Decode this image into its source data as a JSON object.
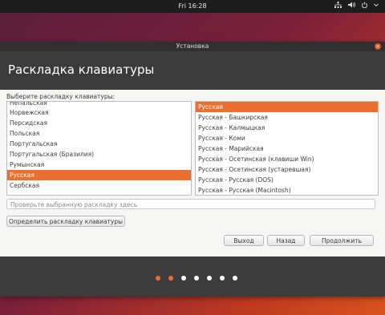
{
  "topbar": {
    "clock": "Fri 16:28"
  },
  "window": {
    "title": "Установка",
    "heading": "Раскладка клавиатуры"
  },
  "layout_prompt": "Выберите раскладку клавиатуры:",
  "layouts_left": [
    "Непальская",
    "Норвежская",
    "Персидская",
    "Польская",
    "Португальская",
    "Португальская (Бразилия)",
    "Румынская",
    "Русская",
    "Сербская"
  ],
  "layouts_left_selected": "Русская",
  "layouts_right": [
    "Русская",
    "Русская - Башкирская",
    "Русская - Калмыцкая",
    "Русская - Коми",
    "Русская - Марийская",
    "Русская - Осетинская (клавиши Win)",
    "Русская - Осетинская (устаревшая)",
    "Русская - Русская (DOS)",
    "Русская - Русская (Macintosh)"
  ],
  "layouts_right_selected": "Русская",
  "test_field": {
    "placeholder": "Проверьте выбранную раскладку здесь"
  },
  "buttons": {
    "detect": "Определить раскладку клавиатуры",
    "quit": "Выход",
    "back": "Назад",
    "next": "Продолжить"
  },
  "progress": {
    "total_steps": 7,
    "completed_steps": 2
  },
  "colors": {
    "accent": "#e9702f",
    "header_bg": "#3b3b3b",
    "titlebar_bg": "#303030"
  }
}
